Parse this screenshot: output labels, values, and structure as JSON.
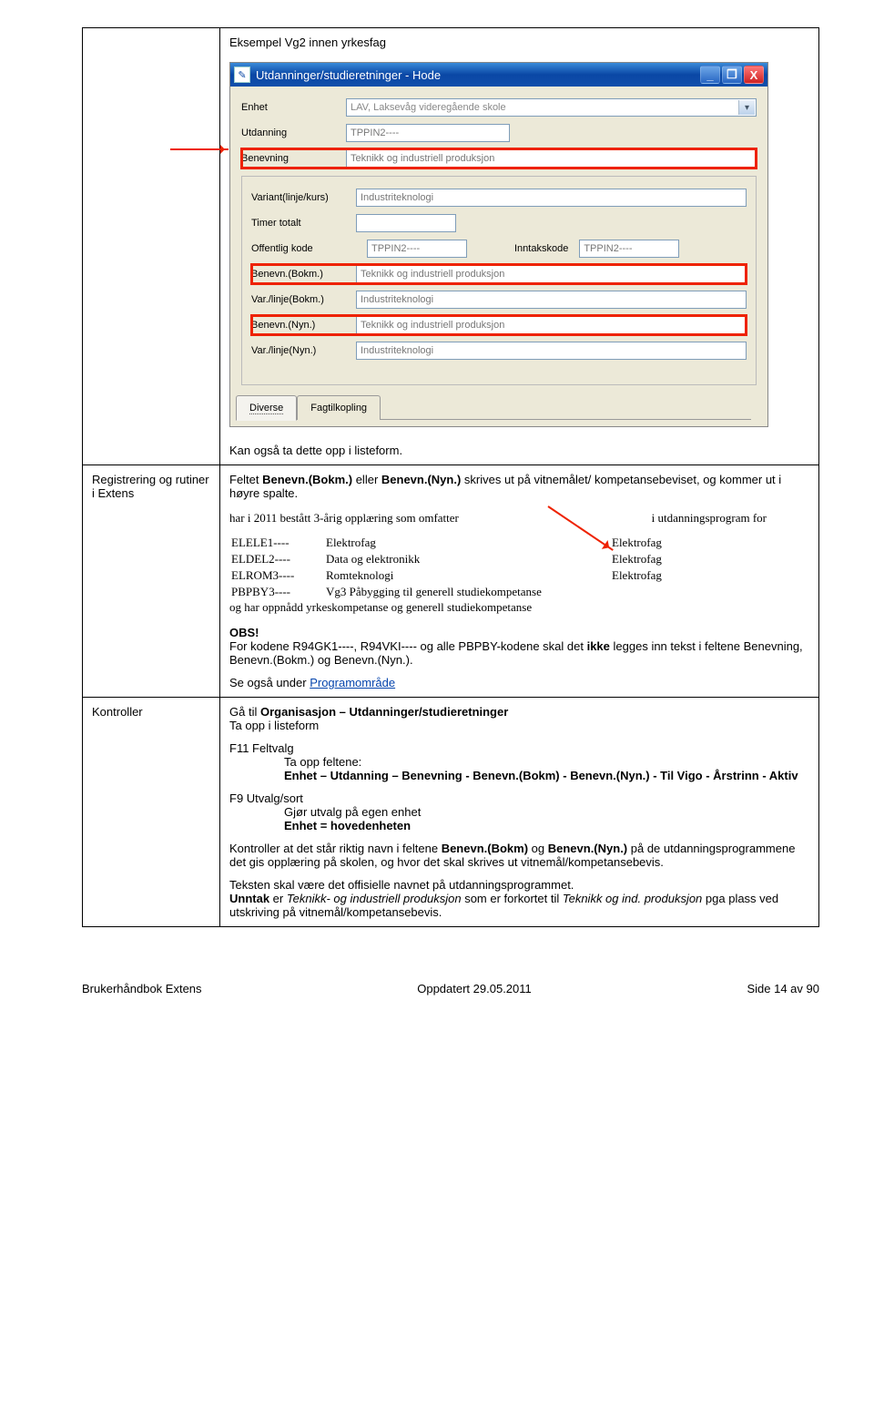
{
  "heading": "Eksempel Vg2 innen yrkesfag",
  "window": {
    "title": "Utdanninger/studieretninger - Hode",
    "minimize": "_",
    "maximize": "❐",
    "close": "X",
    "fields": {
      "enhet_label": "Enhet",
      "enhet_value": "LAV, Laksevåg videregående skole",
      "utdanning_label": "Utdanning",
      "utdanning_value": "TPPIN2----",
      "benevning_label": "Benevning",
      "benevning_value": "Teknikk og industriell produksjon",
      "variant_label": "Variant(linje/kurs)",
      "variant_value": "Industriteknologi",
      "timer_label": "Timer totalt",
      "timer_value": "",
      "offkode_label": "Offentlig kode",
      "offkode_value": "TPPIN2----",
      "inntak_label": "Inntakskode",
      "inntak_value": "TPPIN2----",
      "benevn_bokm_label": "Benevn.(Bokm.)",
      "benevn_bokm_value": "Teknikk og industriell produksjon",
      "varlinje_bokm_label": "Var./linje(Bokm.)",
      "varlinje_bokm_value": "Industriteknologi",
      "benevn_nyn_label": "Benevn.(Nyn.)",
      "benevn_nyn_value": "Teknikk og industriell produksjon",
      "varlinje_nyn_label": "Var./linje(Nyn.)",
      "varlinje_nyn_value": "Industriteknologi"
    },
    "tabs": {
      "diverse": "Diverse",
      "fagtilkopling": "Fagtilkopling"
    }
  },
  "listnote": "Kan også ta dette opp i listeform.",
  "row2": {
    "left": "Registrering og rutiner i Extens",
    "intro_a": "Feltet ",
    "intro_b": "Benevn.(Bokm.)",
    "intro_c": " eller ",
    "intro_d": "Benevn.(Nyn.)",
    "intro_e": " skrives ut på vitnemålet/ kompetansebeviset, og kommer ut i høyre spalte.",
    "excerpt": {
      "toplinje_left": "har i 2011 bestått 3-årig opplæring som omfatter",
      "toplinje_right": "i utdanningsprogram for",
      "rows": [
        {
          "code": "ELELE1----",
          "desc": "Elektrofag",
          "right": "Elektrofag"
        },
        {
          "code": "ELDEL2----",
          "desc": "Data og elektronikk",
          "right": "Elektrofag"
        },
        {
          "code": "ELROM3----",
          "desc": "Romteknologi",
          "right": "Elektrofag"
        },
        {
          "code": "PBPBY3----",
          "desc": "Vg3 Påbygging til generell studiekompetanse",
          "right": ""
        }
      ],
      "bottom": "og har oppnådd yrkeskompetanse og generell studiekompetanse"
    },
    "obs_label": "OBS!",
    "obs_text_a": "For kodene R94GK1----, R94VKI---- og alle PBPBY-kodene skal det ",
    "obs_text_b": "ikke",
    "obs_text_c": " legges inn tekst i feltene Benevning, Benevn.(Bokm.) og Benevn.(Nyn.).",
    "seogsa_a": "Se også under ",
    "seogsa_link": "Programområde"
  },
  "row3": {
    "left": "Kontroller",
    "goto_a": "Gå til ",
    "goto_b": "Organisasjon – Utdanninger/studieretninger",
    "goto_c": "Ta opp i listeform",
    "f11": "F11 Feltvalg",
    "f11_a": "Ta opp feltene:",
    "f11_b_a": "Enhet – Utdanning – Benevning - Benevn.(Bokm) - Benevn.(Nyn.) - Til Vigo - Årstrinn - Aktiv",
    "f9": "F9 Utvalg/sort",
    "f9_a": "Gjør utvalg på egen enhet",
    "f9_b": "Enhet = hovedenheten",
    "kontroller_a": "Kontroller at det står riktig navn i feltene ",
    "kontroller_b": "Benevn.(Bokm)",
    "kontroller_c": " og ",
    "kontroller_d": "Benevn.(Nyn.)",
    "kontroller_e": " på de utdanningsprogrammene det gis opplæring på skolen, og hvor det skal skrives ut vitnemål/kompetansebevis.",
    "tekst1": "Teksten skal være det offisielle navnet på utdanningsprogrammet.",
    "unntak_a": "Unntak",
    "unntak_b": " er ",
    "unntak_c": "Teknikk- og industriell produksjon",
    "unntak_d": " som er forkortet til ",
    "unntak_e": "Teknikk og ind. produksjon",
    "unntak_f": " pga plass ved utskriving på vitnemål/kompetansebevis."
  },
  "footer": {
    "left": "Brukerhåndbok Extens",
    "center": "Oppdatert  29.05.2011",
    "right": "Side 14  av 90"
  }
}
